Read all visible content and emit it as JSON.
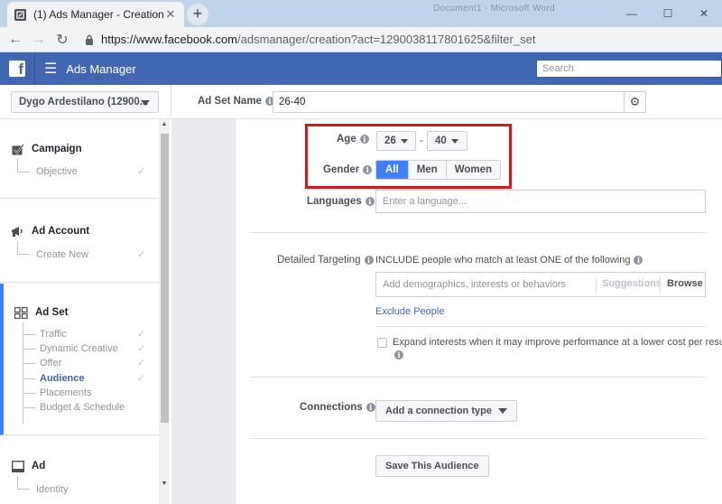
{
  "browser": {
    "tab_title": "(1) Ads Manager - Creation",
    "tab_close": "✕",
    "new_tab": "+",
    "background_window": "Document1 - Microsoft Word",
    "url_host": "https://www.facebook.com",
    "url_path": "/adsmanager/creation?act=1290038117801625&filter_set",
    "minimize": "—",
    "maximize": "☐",
    "close": "✕"
  },
  "header": {
    "logo": "f",
    "app_name": "Ads Manager",
    "search_placeholder": "Search"
  },
  "subbar": {
    "account": "Dygo Ardestilano (12900...",
    "ad_set_name_label": "Ad Set Name",
    "ad_set_name_value": "26-40"
  },
  "sidebar": {
    "campaign": {
      "title": "Campaign",
      "items": [
        "Objective"
      ]
    },
    "ad_account": {
      "title": "Ad Account",
      "items": [
        "Create New"
      ]
    },
    "ad_set": {
      "title": "Ad Set",
      "items": [
        "Traffic",
        "Dynamic Creative",
        "Offer",
        "Audience",
        "Placements",
        "Budget & Schedule"
      ]
    },
    "ad": {
      "title": "Ad",
      "items": [
        "Identity"
      ]
    }
  },
  "form": {
    "age_label": "Age",
    "age_min": "26",
    "age_max": "40",
    "age_sep": "-",
    "gender_label": "Gender",
    "gender_options": [
      "All",
      "Men",
      "Women"
    ],
    "gender_selected": "All",
    "languages_label": "Languages",
    "languages_placeholder": "Enter a language...",
    "detailed_targeting_label": "Detailed Targeting",
    "include_text": "INCLUDE people who match at least ONE of the following",
    "targeting_placeholder": "Add demographics, interests or behaviors",
    "suggestions": "Suggestions",
    "browse": "Browse",
    "exclude_people": "Exclude People",
    "expand_interests": "Expand interests when it may improve performance at a lower cost per result.",
    "connections_label": "Connections",
    "add_connection": "Add a connection type",
    "save_audience": "Save This Audience"
  },
  "colors": {
    "fb_blue": "#4267b2",
    "accent": "#4080ff",
    "highlight_box": "#d7151b"
  }
}
